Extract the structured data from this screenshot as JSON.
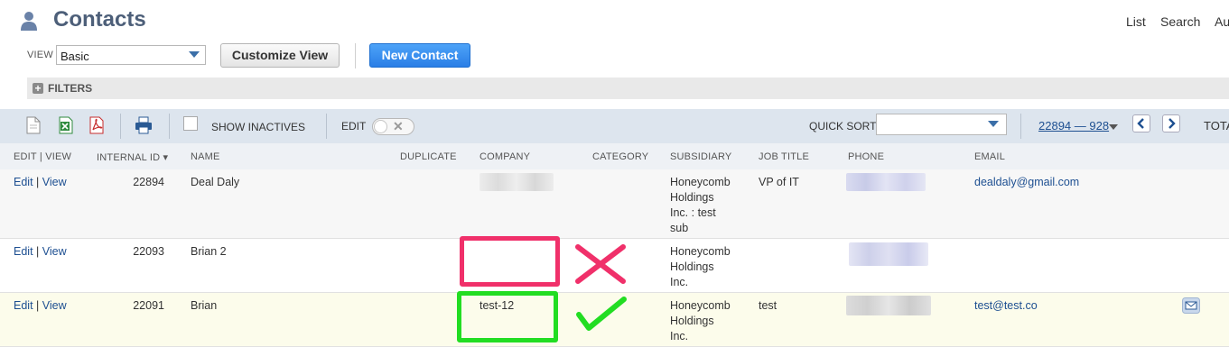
{
  "header": {
    "title": "Contacts",
    "top_links": [
      "List",
      "Search",
      "Au"
    ]
  },
  "view": {
    "label": "VIEW",
    "selected": "Basic",
    "customize_label": "Customize View",
    "new_contact_label": "New Contact"
  },
  "filters": {
    "label": "FILTERS"
  },
  "toolbar": {
    "show_inactives": "SHOW INACTIVES",
    "edit": "EDIT",
    "quick_sort": "QUICK SORT",
    "range": "22894 — 928",
    "total": "TOTA"
  },
  "columns": {
    "edit_view": "EDIT | VIEW",
    "internal_id": "INTERNAL ID ▾",
    "name": "NAME",
    "duplicate": "DUPLICATE",
    "company": "COMPANY",
    "category": "CATEGORY",
    "subsidiary": "SUBSIDIARY",
    "job_title": "JOB TITLE",
    "phone": "PHONE",
    "email": "EMAIL"
  },
  "rows": [
    {
      "edit": "Edit",
      "sep": "|",
      "view": "View",
      "internal_id": "22894",
      "name": "Deal Daly",
      "company": "",
      "subsidiary": [
        "Honeycomb",
        "Holdings",
        "Inc. : test",
        "sub"
      ],
      "job_title": "VP of IT",
      "email": "dealdaly@gmail.com"
    },
    {
      "edit": "Edit",
      "sep": "|",
      "view": "View",
      "internal_id": "22093",
      "name": "Brian 2",
      "company": "",
      "subsidiary": [
        "Honeycomb",
        "Holdings",
        "Inc."
      ],
      "job_title": "",
      "email": ""
    },
    {
      "edit": "Edit",
      "sep": "|",
      "view": "View",
      "internal_id": "22091",
      "name": "Brian",
      "company": "test-12",
      "subsidiary": [
        "Honeycomb",
        "Holdings",
        "Inc."
      ],
      "job_title": "test",
      "email": "test@test.co"
    }
  ],
  "colors": {
    "title": "#4d5f79",
    "link": "#1d4f91",
    "primary_button": "#2a7ee6",
    "toolbar_bg": "#dde5ee",
    "annotation_wrong": "#f0306a",
    "annotation_right": "#22dd22"
  },
  "icons": [
    "person-icon",
    "new-document-icon",
    "export-excel-icon",
    "export-pdf-icon",
    "print-icon",
    "envelope-icon",
    "cross-mark-icon",
    "check-mark-icon"
  ]
}
